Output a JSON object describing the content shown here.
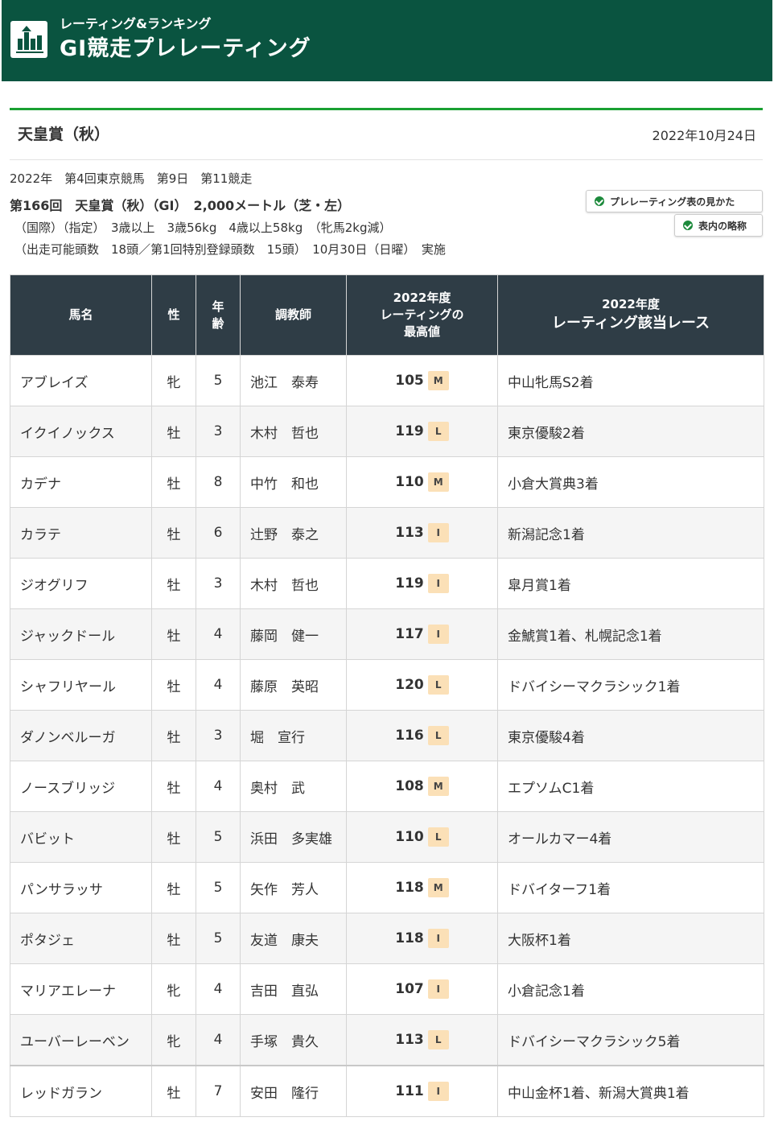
{
  "header": {
    "subtitle": "レーティング&ランキング",
    "title": "GⅠ競走プレレーティング",
    "logo_icon": "chart-bar-icon",
    "color": "#0a5440"
  },
  "race": {
    "name": "天皇賞（秋）",
    "published": "2022年10月24日",
    "meeting": "2022年　第4回東京競馬　第9日　第11競走",
    "title_line": "第166回　天皇賞（秋）（GⅠ）　2,000メートル（芝・左）",
    "conditions": "（国際）（指定）　3歳以上　3歳56kg　4歳以上58kg　（牝馬2kg減）",
    "entries": "（出走可能頭数　18頭／第1回特別登録頭数　15頭）　10月30日（日曜）　実施"
  },
  "buttons": {
    "how_to_read": "プレレーティング表の見かた",
    "abbreviations": "表内の略称"
  },
  "table": {
    "headers": {
      "name": "馬名",
      "sex": "性",
      "age_1": "年",
      "age_2": "齢",
      "trainer": "調教師",
      "rating_1": "2022年度",
      "rating_2": "レーティングの",
      "rating_3": "最高値",
      "race_1": "2022年度",
      "race_2": "レーティング該当レース"
    },
    "rows": [
      {
        "name": "アブレイズ",
        "sex": "牝",
        "age": "5",
        "trainer": "池江　泰寿",
        "rating": "105",
        "cat": "M",
        "race": "中山牝馬S2着"
      },
      {
        "name": "イクイノックス",
        "sex": "牡",
        "age": "3",
        "trainer": "木村　哲也",
        "rating": "119",
        "cat": "L",
        "race": "東京優駿2着"
      },
      {
        "name": "カデナ",
        "sex": "牡",
        "age": "8",
        "trainer": "中竹　和也",
        "rating": "110",
        "cat": "M",
        "race": "小倉大賞典3着"
      },
      {
        "name": "カラテ",
        "sex": "牡",
        "age": "6",
        "trainer": "辻野　泰之",
        "rating": "113",
        "cat": "I",
        "race": "新潟記念1着"
      },
      {
        "name": "ジオグリフ",
        "sex": "牡",
        "age": "3",
        "trainer": "木村　哲也",
        "rating": "119",
        "cat": "I",
        "race": "皐月賞1着"
      },
      {
        "name": "ジャックドール",
        "sex": "牡",
        "age": "4",
        "trainer": "藤岡　健一",
        "rating": "117",
        "cat": "I",
        "race": "金鯱賞1着、札幌記念1着"
      },
      {
        "name": "シャフリヤール",
        "sex": "牡",
        "age": "4",
        "trainer": "藤原　英昭",
        "rating": "120",
        "cat": "L",
        "race": "ドバイシーマクラシック1着"
      },
      {
        "name": "ダノンベルーガ",
        "sex": "牡",
        "age": "3",
        "trainer": "堀　宣行",
        "rating": "116",
        "cat": "L",
        "race": "東京優駿4着"
      },
      {
        "name": "ノースブリッジ",
        "sex": "牡",
        "age": "4",
        "trainer": "奥村　武",
        "rating": "108",
        "cat": "M",
        "race": "エプソムC1着"
      },
      {
        "name": "バビット",
        "sex": "牡",
        "age": "5",
        "trainer": "浜田　多実雄",
        "rating": "110",
        "cat": "L",
        "race": "オールカマー4着"
      },
      {
        "name": "パンサラッサ",
        "sex": "牡",
        "age": "5",
        "trainer": "矢作　芳人",
        "rating": "118",
        "cat": "M",
        "race": "ドバイターフ1着"
      },
      {
        "name": "ポタジェ",
        "sex": "牡",
        "age": "5",
        "trainer": "友道　康夫",
        "rating": "118",
        "cat": "I",
        "race": "大阪杯1着"
      },
      {
        "name": "マリアエレーナ",
        "sex": "牝",
        "age": "4",
        "trainer": "吉田　直弘",
        "rating": "107",
        "cat": "I",
        "race": "小倉記念1着"
      },
      {
        "name": "ユーバーレーベン",
        "sex": "牝",
        "age": "4",
        "trainer": "手塚　貴久",
        "rating": "113",
        "cat": "L",
        "race": "ドバイシーマクラシック5着"
      },
      {
        "name": "レッドガラン",
        "sex": "牡",
        "age": "7",
        "trainer": "安田　隆行",
        "rating": "111",
        "cat": "I",
        "race": "中山金杯1着、新潟大賞典1着"
      }
    ]
  }
}
